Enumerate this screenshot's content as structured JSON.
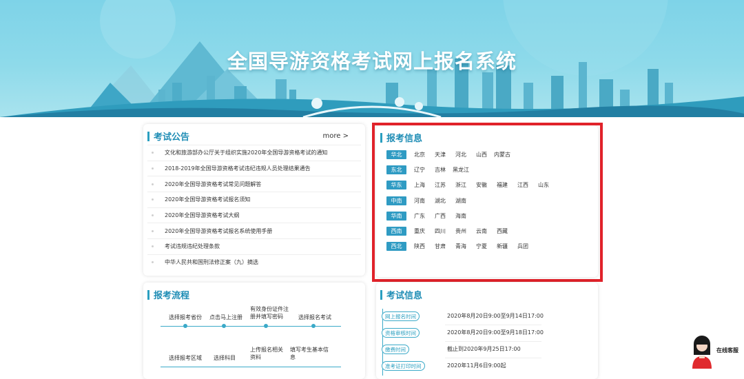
{
  "banner": {
    "title": "全国导游资格考试网上报名系统"
  },
  "notices": {
    "title": "考试公告",
    "more": "more >",
    "items": [
      "文化和旅游部办公厅关于组织实施2020年全国导游资格考试的通知",
      "2018-2019年全国导游资格考试违纪违规人员处理结果通告",
      "2020年全国导游资格考试常见问题解答",
      "2020年全国导游资格考试报名须知",
      "2020年全国导游资格考试大纲",
      "2020年全国导游资格考试报名系统使用手册",
      "考试违规违纪处理条款",
      "中华人民共和国刑法修正案（九）摘选"
    ]
  },
  "registration": {
    "title": "报考信息",
    "regions": [
      {
        "name": "华北",
        "provinces": [
          "北京",
          "天津",
          "河北",
          "山西",
          "内蒙古"
        ]
      },
      {
        "name": "东北",
        "provinces": [
          "辽宁",
          "吉林",
          "黑龙江"
        ]
      },
      {
        "name": "华东",
        "provinces": [
          "上海",
          "江苏",
          "浙江",
          "安徽",
          "福建",
          "江西",
          "山东"
        ]
      },
      {
        "name": "中南",
        "provinces": [
          "河南",
          "湖北",
          "湖南"
        ]
      },
      {
        "name": "华南",
        "provinces": [
          "广东",
          "广西",
          "海南"
        ]
      },
      {
        "name": "西南",
        "provinces": [
          "重庆",
          "四川",
          "贵州",
          "云南",
          "西藏"
        ]
      },
      {
        "name": "西北",
        "provinces": [
          "陕西",
          "甘肃",
          "青海",
          "宁夏",
          "新疆",
          "兵团"
        ]
      }
    ]
  },
  "process": {
    "title": "报考流程",
    "row1": [
      "选择报考省份",
      "点击马上注册",
      "有效身份证件注册并填写密码",
      "选择报名考试"
    ],
    "row2": [
      "选择报考区域",
      "选择科目",
      "上传报名相关资料",
      "填写考生基本信息"
    ]
  },
  "exam_info": {
    "title": "考试信息",
    "rows": [
      {
        "label": "网上报名时间",
        "value": "2020年8月20日9:00至9月14日17:00"
      },
      {
        "label": "资格审核时间",
        "value": "2020年8月20日9:00至9月18日17:00"
      },
      {
        "label": "缴费时间",
        "value": "截止到2020年9月25日17:00"
      },
      {
        "label": "准考证打印时间",
        "value": "2020年11月6日9:00起"
      }
    ]
  },
  "service": {
    "label": "在线客服"
  },
  "colors": {
    "accent": "#2a9fc0",
    "highlight": "#e0222a"
  }
}
